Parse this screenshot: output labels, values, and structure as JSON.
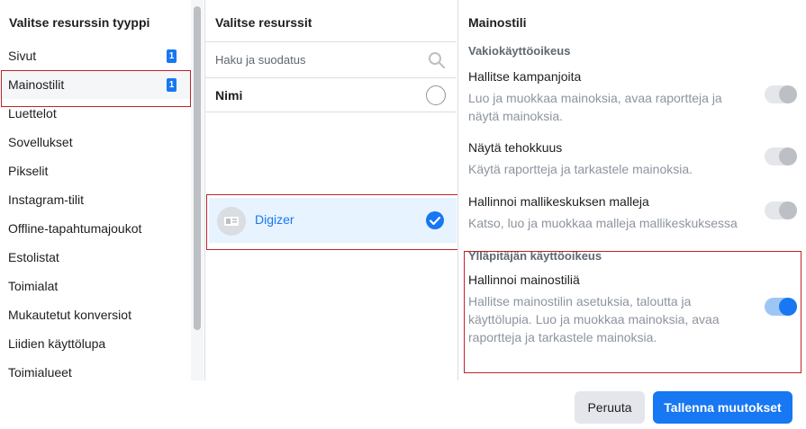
{
  "resource_types": {
    "title": "Valitse resurssin tyyppi",
    "items": [
      {
        "label": "Sivut",
        "badge": "1"
      },
      {
        "label": "Mainostilit",
        "badge": "1"
      },
      {
        "label": "Luettelot"
      },
      {
        "label": "Sovellukset"
      },
      {
        "label": "Pikselit"
      },
      {
        "label": "Instagram-tilit"
      },
      {
        "label": "Offline-tapahtumajoukot"
      },
      {
        "label": "Estolistat"
      },
      {
        "label": "Toimialat"
      },
      {
        "label": "Mukautetut konversiot"
      },
      {
        "label": "Liidien käyttölupa"
      },
      {
        "label": "Toimialueet"
      }
    ]
  },
  "resources": {
    "title": "Valitse resurssit",
    "search_placeholder": "Haku ja suodatus",
    "name_header": "Nimi",
    "selected_item": "Digizer"
  },
  "permissions": {
    "title": "Mainostili",
    "standard_header": "Vakiokäyttöoikeus",
    "items": [
      {
        "title": "Hallitse kampanjoita",
        "desc": "Luo ja muokkaa mainoksia, avaa raportteja ja näytä mainoksia.",
        "enabled": false
      },
      {
        "title": "Näytä tehokkuus",
        "desc": "Käytä raportteja ja tarkastele mainoksia.",
        "enabled": false
      },
      {
        "title": "Hallinnoi mallikeskuksen malleja",
        "desc": "Katso, luo ja muokkaa malleja mallikeskuksessa",
        "enabled": false
      }
    ],
    "admin_header": "Ylläpitäjän käyttöoikeus",
    "admin_item": {
      "title": "Hallinnoi mainostiliä",
      "desc": "Hallitse mainostilin asetuksia, taloutta ja käyttölupia. Luo ja muokkaa mainoksia, avaa raportteja ja tarkastele mainoksia.",
      "enabled": true
    }
  },
  "footer": {
    "cancel_label": "Peruuta",
    "save_label": "Tallenna muutokset"
  },
  "colors": {
    "accent": "#1877f2",
    "highlight_border": "#c0232b"
  }
}
